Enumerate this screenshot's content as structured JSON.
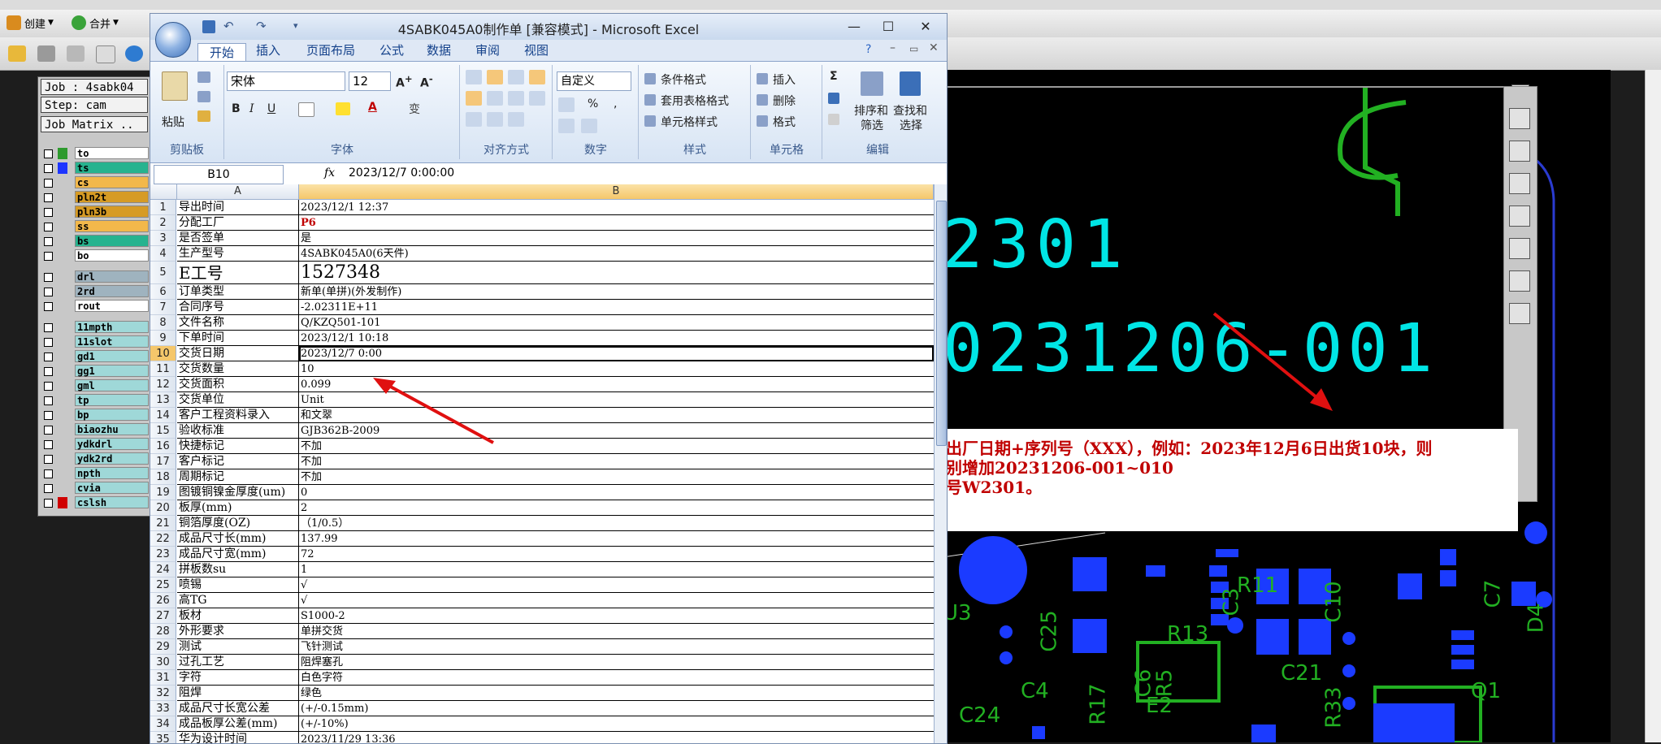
{
  "top_toolbar": {
    "items": [
      {
        "label": "创建",
        "icon": "create-icon"
      },
      {
        "label": "合并",
        "icon": "merge-icon"
      }
    ]
  },
  "cam": {
    "job_label": "Job : 4sabk04",
    "step_label": "Step: cam",
    "matrix_label": "Job Matrix ..",
    "layers": [
      {
        "name": "to",
        "color": "#ffffff",
        "swatch": "#2e9a2e"
      },
      {
        "name": "ts",
        "color": "#27b38f",
        "swatch": "#1d35ff"
      },
      {
        "name": "cs",
        "color": "#f2b84b",
        "swatch": "#c8c8c8"
      },
      {
        "name": "pln2t",
        "color": "#d69b25",
        "swatch": "#c8c8c8"
      },
      {
        "name": "pln3b",
        "color": "#d69b25",
        "swatch": "#c8c8c8"
      },
      {
        "name": "ss",
        "color": "#f2b84b",
        "swatch": "#c8c8c8"
      },
      {
        "name": "bs",
        "color": "#27b38f",
        "swatch": "#c8c8c8"
      },
      {
        "name": "bo",
        "color": "#ffffff",
        "swatch": "#c8c8c8"
      },
      {
        "name": "drl",
        "color": "#9fb3bf",
        "swatch": "#c8c8c8"
      },
      {
        "name": "2rd",
        "color": "#9fb3bf",
        "swatch": "#c8c8c8"
      },
      {
        "name": "rout",
        "color": "#ffffff",
        "swatch": "#c8c8c8"
      },
      {
        "name": "11mpth",
        "color": "#9fd8d8",
        "swatch": "#c8c8c8"
      },
      {
        "name": "11slot",
        "color": "#9fd8d8",
        "swatch": "#c8c8c8"
      },
      {
        "name": "gd1",
        "color": "#9fd8d8",
        "swatch": "#c8c8c8"
      },
      {
        "name": "gg1",
        "color": "#9fd8d8",
        "swatch": "#c8c8c8"
      },
      {
        "name": "gml",
        "color": "#9fd8d8",
        "swatch": "#c8c8c8"
      },
      {
        "name": "tp",
        "color": "#9fd8d8",
        "swatch": "#c8c8c8"
      },
      {
        "name": "bp",
        "color": "#9fd8d8",
        "swatch": "#c8c8c8"
      },
      {
        "name": "biaozhu",
        "color": "#9fd8d8",
        "swatch": "#c8c8c8"
      },
      {
        "name": "ydkdrl",
        "color": "#9fd8d8",
        "swatch": "#c8c8c8"
      },
      {
        "name": "ydk2rd",
        "color": "#9fd8d8",
        "swatch": "#c8c8c8"
      },
      {
        "name": "npth",
        "color": "#9fd8d8",
        "swatch": "#c8c8c8"
      },
      {
        "name": "cvia",
        "color": "#9fd8d8",
        "swatch": "#c8c8c8"
      },
      {
        "name": "cslsh",
        "color": "#9fd8d8",
        "swatch": "#d00000"
      }
    ],
    "board_text_1": "2301",
    "board_text_2": "0231206-001",
    "silk_labels": [
      "R11",
      "C3",
      "C10",
      "C7",
      "D4",
      "U3",
      "C25",
      "R13",
      "R17",
      "C4",
      "C6",
      "R5",
      "C21",
      "R33",
      "Q1",
      "C24",
      "E2"
    ],
    "note_lines": [
      "出厂日期+序列号（XXX），例如：2023年12月6日出货10块，则",
      "别增加20231206-001~010",
      "号W2301。"
    ]
  },
  "excel": {
    "title": "4SABK045A0制作单 [兼容模式] - Microsoft Excel",
    "tabs": [
      "开始",
      "插入",
      "页面布局",
      "公式",
      "数据",
      "审阅",
      "视图"
    ],
    "active_tab": "开始",
    "ribbon": {
      "paste": "粘贴",
      "clipboard": "剪贴板",
      "font_name": "宋体",
      "font_size": "12",
      "font_group": "字体",
      "align_group": "对齐方式",
      "number_format": "自定义",
      "number_group": "数字",
      "cond_format": "条件格式",
      "table_format": "套用表格格式",
      "cell_style": "单元格样式",
      "style_group": "样式",
      "insert": "插入",
      "delete": "删除",
      "format": "格式",
      "cells_group": "单元格",
      "sort_filter_1": "排序和",
      "sort_filter_2": "筛选",
      "find_select_1": "查找和",
      "find_select_2": "选择",
      "edit_group": "编辑"
    },
    "name_box": "B10",
    "formula": "2023/12/7  0:00:00",
    "col_a": "A",
    "col_b": "B",
    "rows": [
      {
        "n": "1",
        "a": "导出时间",
        "b": "2023/12/1 12:37"
      },
      {
        "n": "2",
        "a": "分配工厂",
        "b": "P6"
      },
      {
        "n": "3",
        "a": "是否签单",
        "b": "是"
      },
      {
        "n": "4",
        "a": "生产型号",
        "b": "4SABK045A0(6天件)"
      },
      {
        "n": "5",
        "a": "E工号",
        "b": "1527348"
      },
      {
        "n": "6",
        "a": "订单类型",
        "b": "新单(单拼)(外发制作)"
      },
      {
        "n": "7",
        "a": "合同序号",
        "b": "-2.02311E+11"
      },
      {
        "n": "8",
        "a": "文件名称",
        "b": "Q/KZQ501-101"
      },
      {
        "n": "9",
        "a": "下单时间",
        "b": "2023/12/1 10:18"
      },
      {
        "n": "10",
        "a": "交货日期",
        "b": "2023/12/7 0:00"
      },
      {
        "n": "11",
        "a": "交货数量",
        "b": "10"
      },
      {
        "n": "12",
        "a": "交货面积",
        "b": "0.099"
      },
      {
        "n": "13",
        "a": "交货单位",
        "b": "Unit"
      },
      {
        "n": "14",
        "a": "客户工程资料录入",
        "b": "和文翠"
      },
      {
        "n": "15",
        "a": "验收标准",
        "b": "GJB362B-2009"
      },
      {
        "n": "16",
        "a": "快捷标记",
        "b": "不加"
      },
      {
        "n": "17",
        "a": "客户标记",
        "b": "不加"
      },
      {
        "n": "18",
        "a": "周期标记",
        "b": "不加"
      },
      {
        "n": "19",
        "a": "图镀铜镍金厚度(um)",
        "b": "0"
      },
      {
        "n": "20",
        "a": "板厚(mm)",
        "b": "2"
      },
      {
        "n": "21",
        "a": "铜箔厚度(OZ)",
        "b": "（1/0.5）"
      },
      {
        "n": "22",
        "a": "成品尺寸长(mm)",
        "b": "137.99"
      },
      {
        "n": "23",
        "a": "成品尺寸宽(mm)",
        "b": "72"
      },
      {
        "n": "24",
        "a": "拼板数su",
        "b": "1"
      },
      {
        "n": "25",
        "a": "喷锡",
        "b": "√"
      },
      {
        "n": "26",
        "a": "高TG",
        "b": "√"
      },
      {
        "n": "27",
        "a": "板材",
        "b": "S1000-2"
      },
      {
        "n": "28",
        "a": "外形要求",
        "b": "单拼交货"
      },
      {
        "n": "29",
        "a": "测试",
        "b": "飞针测试"
      },
      {
        "n": "30",
        "a": "过孔工艺",
        "b": "阻焊塞孔"
      },
      {
        "n": "31",
        "a": "字符",
        "b": "白色字符"
      },
      {
        "n": "32",
        "a": "阻焊",
        "b": "绿色"
      },
      {
        "n": "33",
        "a": "成品尺寸长宽公差",
        "b": "(+/-0.15mm)"
      },
      {
        "n": "34",
        "a": "成品板厚公差(mm)",
        "b": "(+/-10%)"
      },
      {
        "n": "35",
        "a": "华为设计时间",
        "b": "2023/11/29 13:36"
      }
    ]
  },
  "colors": {
    "annotation_arrow": "#e01010",
    "pcb_text": "#00e5e5",
    "pcb_silk": "#22b022",
    "pcb_pad": "#1b3bff"
  }
}
